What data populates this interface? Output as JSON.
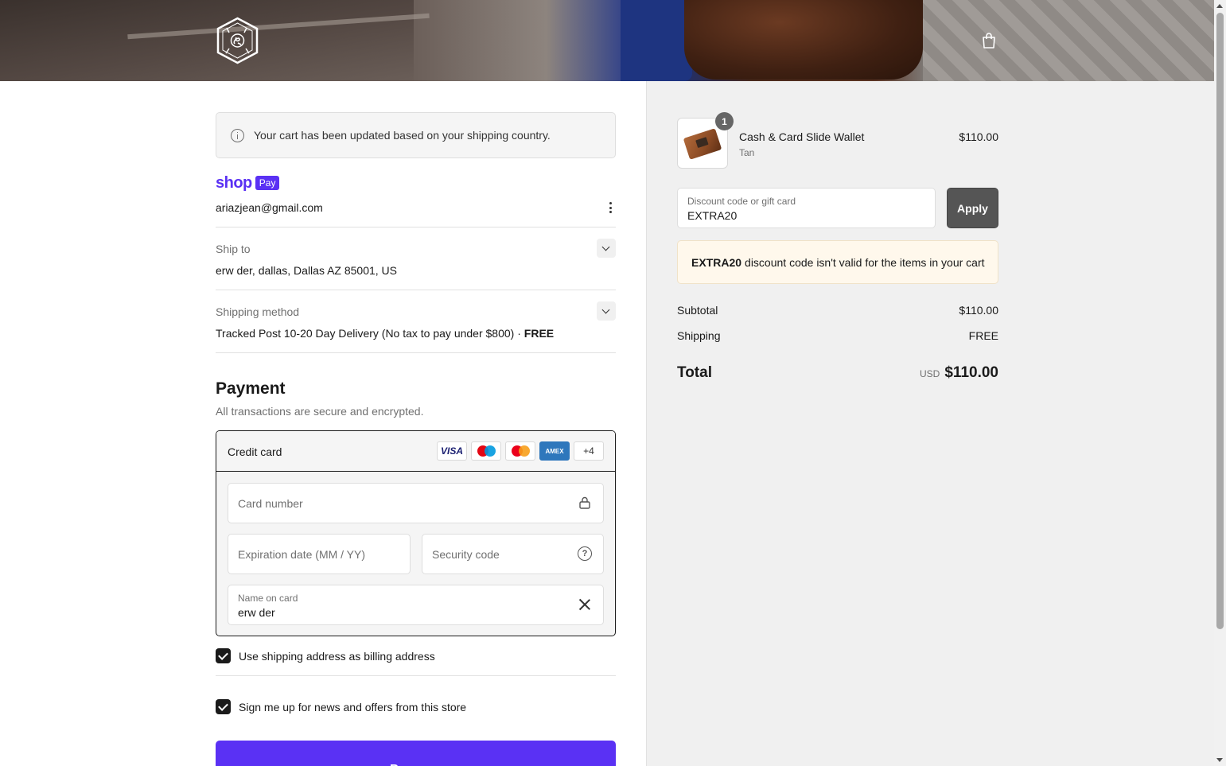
{
  "notice": {
    "text": "Your cart has been updated based on your shipping country."
  },
  "shoppay": {
    "brand": "shop",
    "pay_label": "Pay"
  },
  "account": {
    "email": "ariazjean@gmail.com"
  },
  "ship_to": {
    "label": "Ship to",
    "value": "erw der, dallas, Dallas AZ 85001, US"
  },
  "shipping_method": {
    "label": "Shipping method",
    "value": "Tracked Post 10-20 Day Delivery (No tax to pay under $800) · ",
    "price": "FREE"
  },
  "payment": {
    "title": "Payment",
    "subtitle": "All transactions are secure and encrypted.",
    "method_label": "Credit card",
    "brands": {
      "visa": "VISA",
      "amex": "AMEX",
      "more": "+4"
    },
    "card_number": {
      "placeholder": "Card number"
    },
    "expiration": {
      "placeholder": "Expiration date (MM / YY)"
    },
    "security": {
      "placeholder": "Security code",
      "help": "?"
    },
    "name_on_card": {
      "label": "Name on card",
      "value": "erw der"
    }
  },
  "billing_checkbox": {
    "label": "Use shipping address as billing address",
    "checked": true
  },
  "news_checkbox": {
    "label": "Sign me up for news and offers from this store",
    "checked": true
  },
  "pay_button": {
    "label": "Pay now"
  },
  "cart": {
    "quantity_badge": "1",
    "item": {
      "name": "Cash & Card Slide Wallet",
      "variant": "Tan",
      "price": "$110.00"
    }
  },
  "discount": {
    "label": "Discount code or gift card",
    "value": "EXTRA20",
    "apply_label": "Apply"
  },
  "discount_warning": {
    "code": "EXTRA20",
    "message": "discount code isn't valid for the items in your cart"
  },
  "summary": {
    "subtotal_label": "Subtotal",
    "subtotal_value": "$110.00",
    "shipping_label": "Shipping",
    "shipping_value": "FREE",
    "total_label": "Total",
    "total_currency": "USD",
    "total_value": "$110.00"
  },
  "colors": {
    "accent": "#5a31f4",
    "text": "#1a1a1a",
    "muted": "#707070",
    "warning_bg": "#fff8ec"
  }
}
